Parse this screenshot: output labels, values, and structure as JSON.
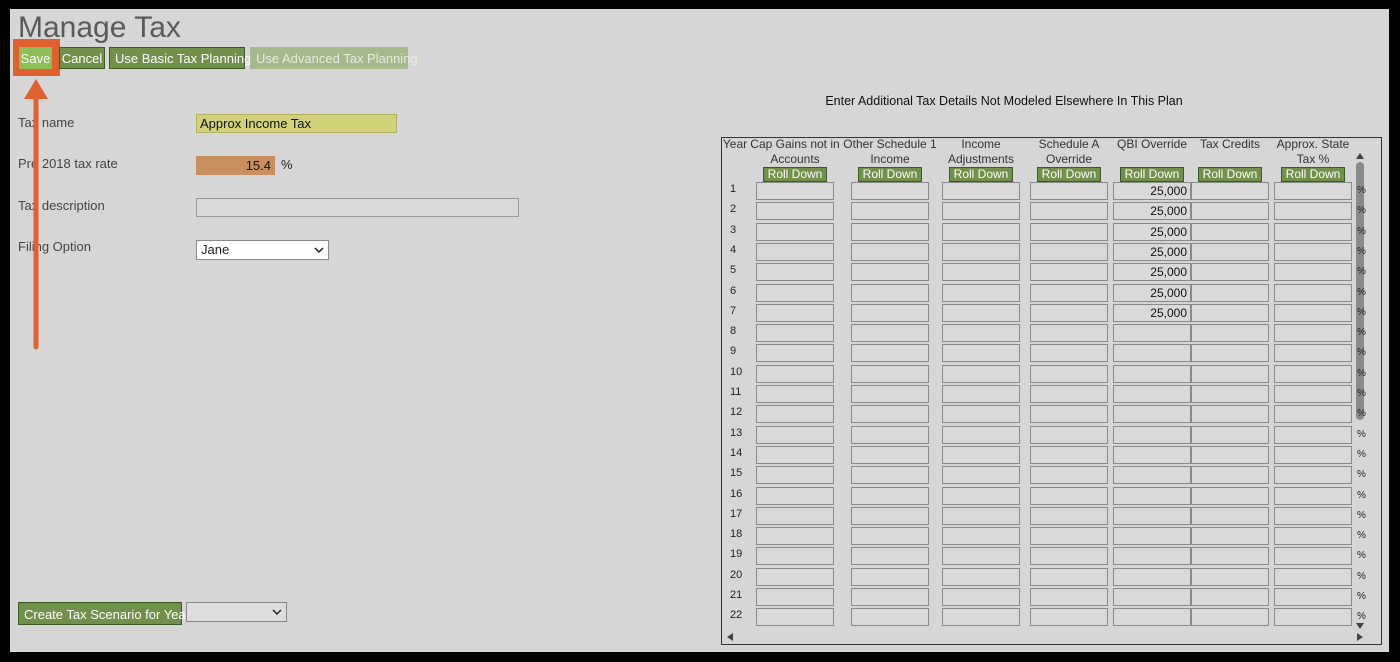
{
  "page": {
    "title": "Manage Tax"
  },
  "toolbar": {
    "save_label": "Save",
    "cancel_label": "Cancel",
    "basic_label": "Use Basic Tax Planning",
    "advanced_label": "Use Advanced Tax Planning"
  },
  "form": {
    "tax_name_label": "Tax name",
    "tax_name_value": "Approx Income Tax",
    "rate_label": "Pre 2018 tax rate",
    "rate_value": "15.4",
    "rate_unit": "%",
    "description_label": "Tax description",
    "description_value": "",
    "filing_label": "Filing Option",
    "filing_value": "Jane"
  },
  "scenario": {
    "button_label": "Create Tax Scenario for Year",
    "year_value": ""
  },
  "details": {
    "title": "Enter Additional Tax Details Not Modeled Elsewhere In This Plan",
    "year_header": "Year",
    "roll_label": "Roll Down",
    "pct_symbol": "%",
    "columns": [
      {
        "l1": "Cap Gains not in",
        "l2": "Accounts"
      },
      {
        "l1": "Other Schedule 1",
        "l2": "Income"
      },
      {
        "l1": "Income",
        "l2": "Adjustments"
      },
      {
        "l1": "Schedule A",
        "l2": "Override"
      },
      {
        "l1": "QBI Override",
        "l2": ""
      },
      {
        "l1": "Tax Credits",
        "l2": ""
      },
      {
        "l1": "Approx. State",
        "l2": "Tax %"
      }
    ],
    "rows": [
      {
        "year": "1",
        "qbi": "25,000"
      },
      {
        "year": "2",
        "qbi": "25,000"
      },
      {
        "year": "3",
        "qbi": "25,000"
      },
      {
        "year": "4",
        "qbi": "25,000"
      },
      {
        "year": "5",
        "qbi": "25,000"
      },
      {
        "year": "6",
        "qbi": "25,000"
      },
      {
        "year": "7",
        "qbi": "25,000"
      },
      {
        "year": "8",
        "qbi": ""
      },
      {
        "year": "9",
        "qbi": ""
      },
      {
        "year": "10",
        "qbi": ""
      },
      {
        "year": "11",
        "qbi": ""
      },
      {
        "year": "12",
        "qbi": ""
      },
      {
        "year": "13",
        "qbi": ""
      },
      {
        "year": "14",
        "qbi": ""
      },
      {
        "year": "15",
        "qbi": ""
      },
      {
        "year": "16",
        "qbi": ""
      },
      {
        "year": "17",
        "qbi": ""
      },
      {
        "year": "18",
        "qbi": ""
      },
      {
        "year": "19",
        "qbi": ""
      },
      {
        "year": "20",
        "qbi": ""
      },
      {
        "year": "21",
        "qbi": ""
      },
      {
        "year": "22",
        "qbi": ""
      }
    ]
  },
  "colors": {
    "button": "#71914a",
    "highlight": "#e0612e",
    "name_field": "#d2d27a",
    "rate_field": "#c8905e"
  }
}
